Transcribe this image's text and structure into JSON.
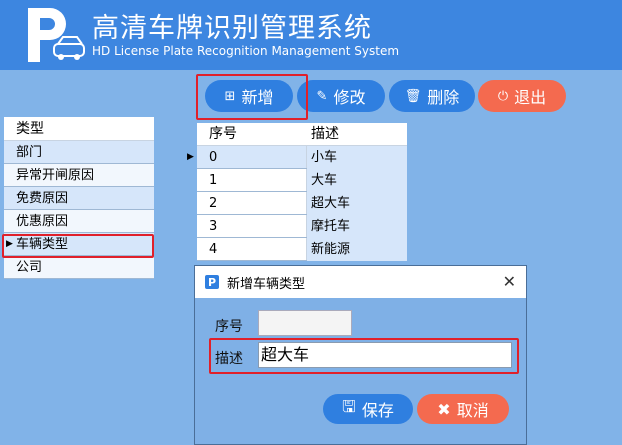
{
  "header": {
    "title": "高清车牌识别管理系统",
    "subtitle": "HD License Plate Recognition Management System"
  },
  "toolbar": {
    "add": "新增",
    "edit": "修改",
    "delete": "删除",
    "exit": "退出"
  },
  "types": {
    "header": "类型",
    "items": [
      "部门",
      "异常开闸原因",
      "免费原因",
      "优惠原因",
      "车辆类型",
      "公司"
    ],
    "selected_index": 4
  },
  "grid": {
    "columns": [
      "序号",
      "描述"
    ],
    "rows": [
      [
        "0",
        "小车"
      ],
      [
        "1",
        "大车"
      ],
      [
        "2",
        "超大车"
      ],
      [
        "3",
        "摩托车"
      ],
      [
        "4",
        "新能源"
      ]
    ]
  },
  "dialog": {
    "title": "新增车辆类型",
    "id_label": "序号",
    "id_value": "",
    "desc_label": "描述",
    "desc_value": "超大车",
    "save": "保存",
    "cancel": "取消"
  },
  "colors": {
    "header": "#3d86e0",
    "button": "#2f7fe0",
    "exit_button": "#f46a4f",
    "highlight": "#e0202a"
  }
}
